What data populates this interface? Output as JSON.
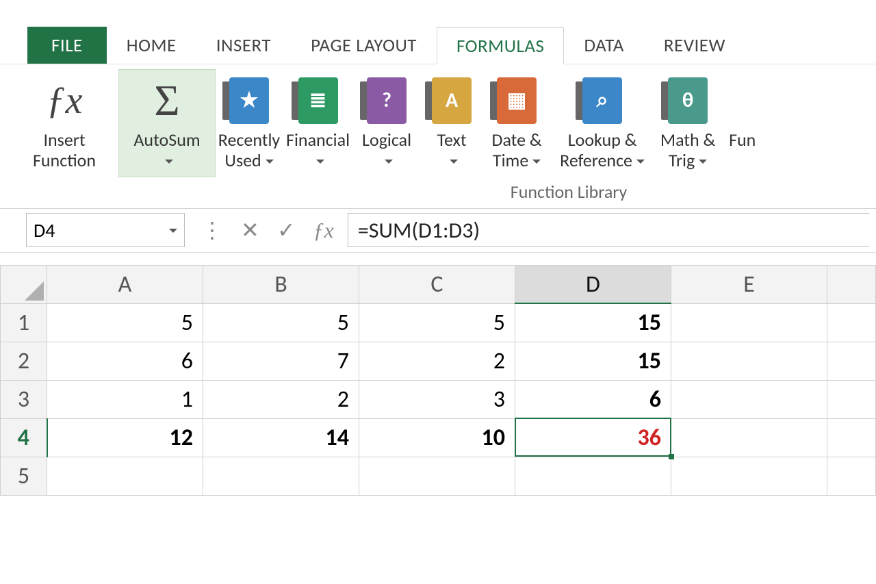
{
  "tabs": {
    "file": "FILE",
    "home": "HOME",
    "insert": "INSERT",
    "pageLayout": "PAGE LAYOUT",
    "formulas": "FORMULAS",
    "data": "DATA",
    "review": "REVIEW"
  },
  "ribbon": {
    "insertFunction": {
      "l1": "Insert",
      "l2": "Function"
    },
    "autoSum": "AutoSum",
    "recentlyUsed": {
      "l1": "Recently",
      "l2": "Used"
    },
    "financial": "Financial",
    "logical": "Logical",
    "text": "Text",
    "dateTime": {
      "l1": "Date &",
      "l2": "Time"
    },
    "lookup": {
      "l1": "Lookup &",
      "l2": "Reference"
    },
    "math": {
      "l1": "Math &",
      "l2": "Trig"
    },
    "funPartial": "Fun",
    "groupLabel": "Function Library"
  },
  "formulaBar": {
    "nameBox": "D4",
    "formula": "=SUM(D1:D3)"
  },
  "sheet": {
    "columns": [
      "A",
      "B",
      "C",
      "D",
      "E"
    ],
    "rows": [
      "1",
      "2",
      "3",
      "4",
      "5"
    ],
    "selectedColumn": "D",
    "selectedRow": "4",
    "cells": {
      "r1": {
        "A": "5",
        "B": "5",
        "C": "5",
        "D": "15"
      },
      "r2": {
        "A": "6",
        "B": "7",
        "C": "2",
        "D": "15"
      },
      "r3": {
        "A": "1",
        "B": "2",
        "C": "3",
        "D": "6"
      },
      "r4": {
        "A": "12",
        "B": "14",
        "C": "10",
        "D": "36"
      }
    }
  },
  "icons": {
    "fx": "ƒx",
    "sigma": "Σ",
    "star": "★",
    "coins": "≣",
    "q": "?",
    "A": "A",
    "cal": "▦",
    "search": "⌕",
    "theta": "θ",
    "dots": "⋮",
    "x": "✕",
    "check": "✓"
  }
}
